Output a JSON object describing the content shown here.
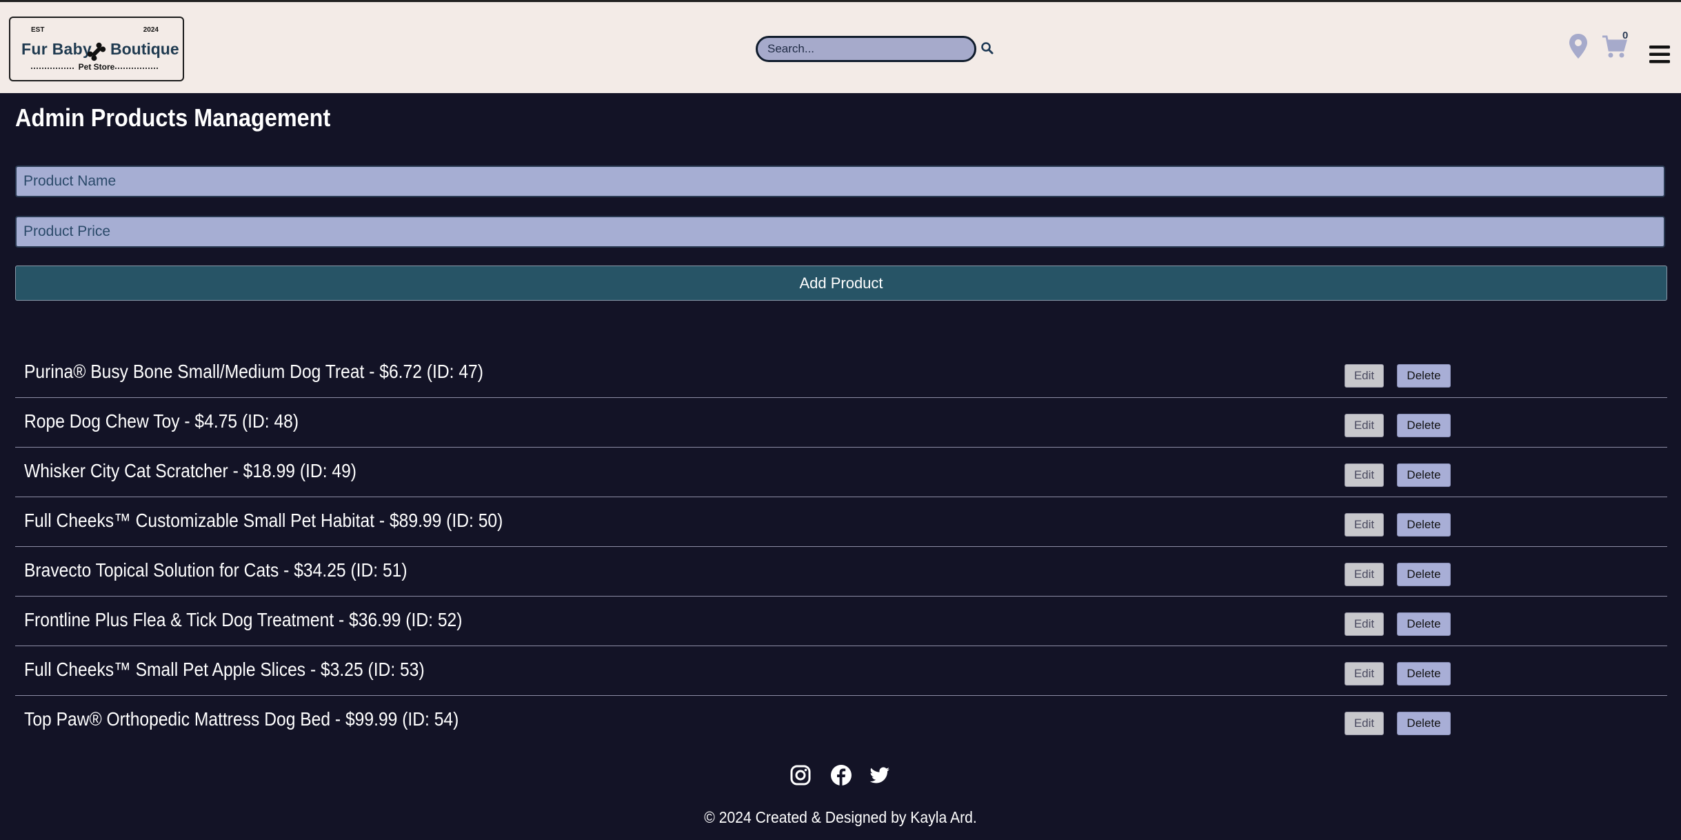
{
  "header": {
    "logo": {
      "est": "EST",
      "year": "2024",
      "brand_left": "Fur Baby",
      "brand_right": "Boutique",
      "subtitle": "Pet Store"
    },
    "search": {
      "placeholder": "Search..."
    },
    "cart_count": "0",
    "icons": {
      "search": "search-icon",
      "location": "map-pin-icon",
      "cart": "cart-icon",
      "menu": "hamburger-menu-icon"
    }
  },
  "main": {
    "title": "Admin Products Management",
    "form": {
      "name_placeholder": "Product Name",
      "price_placeholder": "Product Price",
      "add_label": "Add Product"
    },
    "products": [
      {
        "text": "Purina® Busy Bone Small/Medium Dog Treat - $6.72 (ID: 47)",
        "edit": "Edit",
        "delete": "Delete"
      },
      {
        "text": "Rope Dog Chew Toy - $4.75 (ID: 48)",
        "edit": "Edit",
        "delete": "Delete"
      },
      {
        "text": "Whisker City Cat Scratcher - $18.99 (ID: 49)",
        "edit": "Edit",
        "delete": "Delete"
      },
      {
        "text": "Full Cheeks™ Customizable Small Pet Habitat - $89.99 (ID: 50)",
        "edit": "Edit",
        "delete": "Delete"
      },
      {
        "text": "Bravecto Topical Solution for Cats - $34.25 (ID: 51)",
        "edit": "Edit",
        "delete": "Delete"
      },
      {
        "text": "Frontline Plus Flea & Tick Dog Treatment - $36.99 (ID: 52)",
        "edit": "Edit",
        "delete": "Delete"
      },
      {
        "text": "Full Cheeks™ Small Pet Apple Slices - $3.25 (ID: 53)",
        "edit": "Edit",
        "delete": "Delete"
      },
      {
        "text": "Top Paw® Orthopedic Mattress Dog Bed - $99.99 (ID: 54)",
        "edit": "Edit",
        "delete": "Delete"
      }
    ]
  },
  "footer": {
    "social_icons": [
      "instagram-icon",
      "facebook-icon",
      "twitter-icon"
    ],
    "copyright": "© 2024 Created & Designed by Kayla Ard."
  },
  "colors": {
    "page_background": "#131326",
    "header_background": "#f3ebe7",
    "input_background": "#a6aed3",
    "add_button": "#275466",
    "edit_button": "#c8c8cc",
    "delete_button": "#a8aed6",
    "icon_accent": "#a6aacb"
  }
}
